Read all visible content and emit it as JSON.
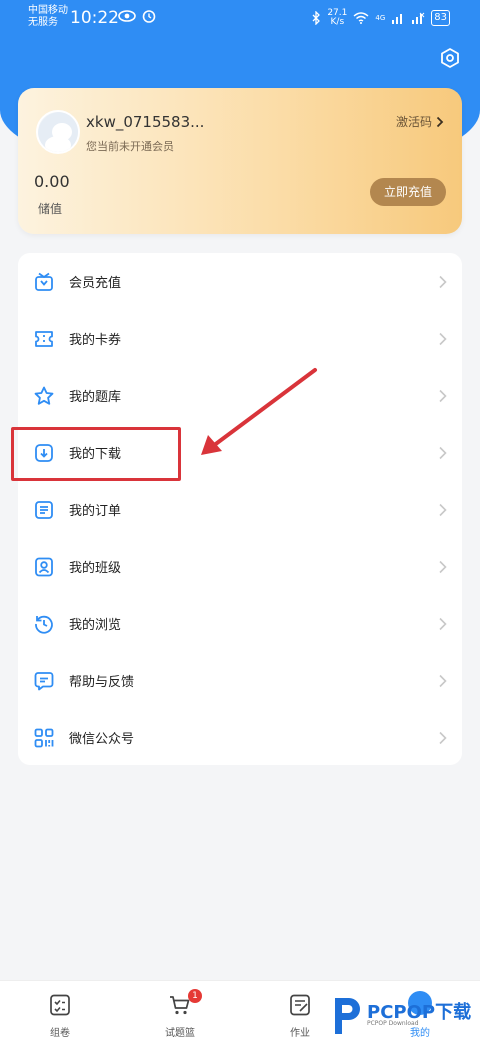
{
  "status_bar": {
    "carrier_line1": "中国移动",
    "carrier_line2": "无服务",
    "time": "10:22",
    "net_speed_value": "27.1",
    "net_speed_unit": "K/s",
    "signal_tag": "4G",
    "battery": "83"
  },
  "member_card": {
    "username": "xkw_0715583...",
    "status": "您当前未开通会员",
    "activate_label": "激活码",
    "balance": "0.00",
    "balance_label": "储值",
    "recharge_label": "立即充值"
  },
  "menu": {
    "items": [
      {
        "label": "会员充值",
        "icon": "shopping-bag-icon"
      },
      {
        "label": "我的卡券",
        "icon": "ticket-icon"
      },
      {
        "label": "我的题库",
        "icon": "star-icon"
      },
      {
        "label": "我的下载",
        "icon": "download-icon"
      },
      {
        "label": "我的订单",
        "icon": "document-icon"
      },
      {
        "label": "我的班级",
        "icon": "person-icon"
      },
      {
        "label": "我的浏览",
        "icon": "history-icon"
      },
      {
        "label": "帮助与反馈",
        "icon": "chat-icon"
      },
      {
        "label": "微信公众号",
        "icon": "grid-icon"
      }
    ]
  },
  "tabbar": {
    "tabs": [
      {
        "label": "组卷",
        "icon": "checklist-icon"
      },
      {
        "label": "试题篮",
        "icon": "cart-icon",
        "badge": "1"
      },
      {
        "label": "作业",
        "icon": "homework-icon"
      },
      {
        "label": "我的",
        "icon": "profile-icon"
      }
    ]
  },
  "watermark": {
    "brand": "PCPOP下载",
    "sub": "PCPOP Download"
  },
  "colors": {
    "accent": "#2f8df4",
    "card_gold": "#b3874f",
    "highlight_red": "#d9343a"
  }
}
